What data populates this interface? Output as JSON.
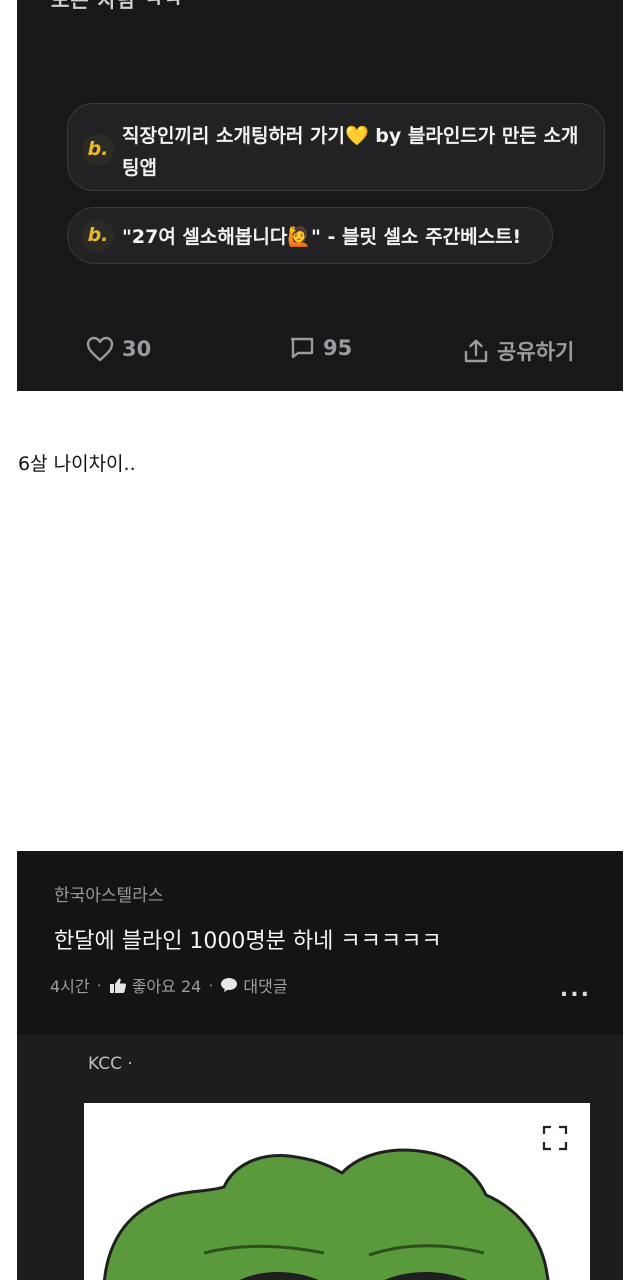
{
  "post_card": {
    "cut_text": "모든 사람 ㅋㅋ",
    "ads": [
      {
        "logo": "b.",
        "text": "직장인끼리 소개팅하러 가기💛 by 블라인드가 만든 소개팅앱"
      },
      {
        "logo": "b.",
        "text": "\"27여 셀소해봅니다🙋\" - 블릿 셀소 주간베스트!"
      }
    ],
    "likes": "30",
    "comments": "95",
    "share_label": "공유하기"
  },
  "caption": "6살 나이차이..",
  "post2": {
    "company": "한국아스텔라스",
    "title": "한달에 블라인 1000명분 하네 ㅋㅋㅋㅋㅋ",
    "time": "4시간",
    "likes_label": "좋아요 24",
    "reply_label": "대댓글",
    "more_label": "...",
    "comment_author": "KCC ·"
  },
  "colors": {
    "accent_logo": "#e8b92d",
    "frog_green": "#5a9a3c"
  }
}
